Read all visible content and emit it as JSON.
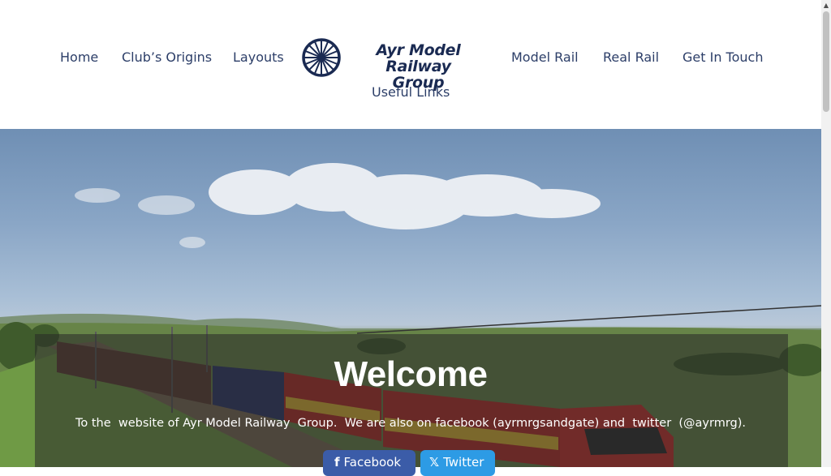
{
  "nav": {
    "home": "Home",
    "origins": "Club’s Origins",
    "layouts": "Layouts",
    "model_rail": "Model Rail",
    "real_rail": "Real Rail",
    "contact": "Get In Touch",
    "useful_links": "Useful Links"
  },
  "logo": {
    "line1": "Ayr Model Railway",
    "line2": "Group",
    "icon": "wheel-icon"
  },
  "hero": {
    "title": "Welcome",
    "intro": "To the  website of Ayr Model Railway  Group.  We are also on facebook (ayrmrgsandgate) and  twitter  (@ayrmrg)."
  },
  "social": {
    "facebook_label": "Facebook",
    "facebook_icon": "facebook-icon",
    "twitter_label": "Twitter",
    "twitter_icon": "x-icon"
  },
  "colors": {
    "nav_text": "#2c3e68",
    "facebook": "#3b5ca8",
    "twitter": "#2d9be5"
  }
}
